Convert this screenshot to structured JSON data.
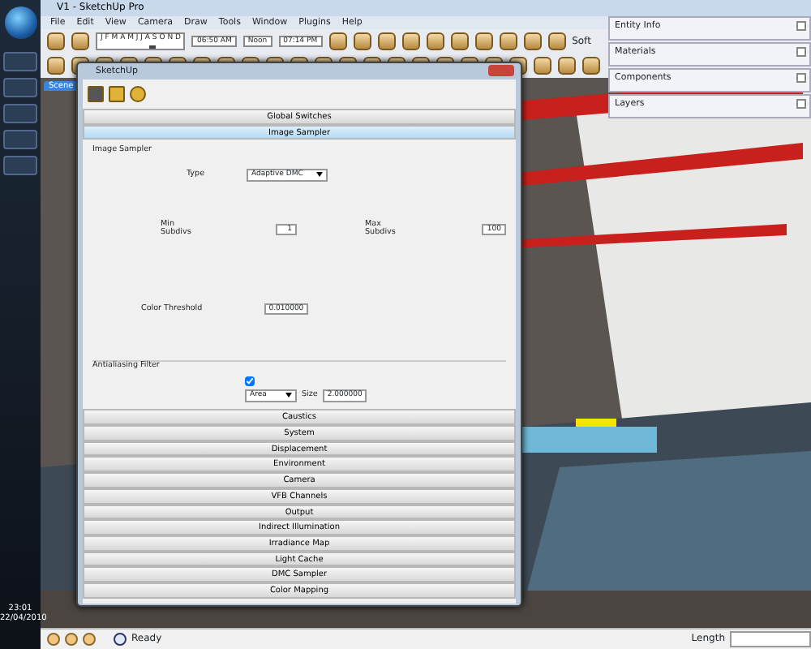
{
  "taskbar": {
    "clock_time": "23:01",
    "clock_date": "22/04/2010"
  },
  "window": {
    "title": "V1 - SketchUp Pro"
  },
  "menu": [
    "File",
    "Edit",
    "View",
    "Camera",
    "Draw",
    "Tools",
    "Window",
    "Plugins",
    "Help"
  ],
  "shadow_toolbar": {
    "month_slider": {
      "scale": "J F M A M J J A S O N D",
      "level": 0.6
    },
    "time_start": "06:50 AM",
    "time_noon": "Noon",
    "time_end": "07:14 PM"
  },
  "style_label": "Soft",
  "scene_tabs": [
    {
      "label": "Scene",
      "selected": true
    }
  ],
  "trays": [
    {
      "title": "Entity Info"
    },
    {
      "title": "Materials"
    },
    {
      "title": "Components"
    },
    {
      "title": "Layers"
    }
  ],
  "dialog": {
    "title": "SketchUp",
    "sections_above": [
      {
        "label": "Global Switches",
        "selected": false
      },
      {
        "label": "Image Sampler",
        "selected": true
      }
    ],
    "image_sampler": {
      "group_title": "Image Sampler",
      "type_label": "Type",
      "type_value": "Adaptive DMC",
      "min_label": "Min Subdivs",
      "min_value": "1",
      "max_label": "Max Subdivs",
      "max_value": "100",
      "threshold_label": "Color Threshold",
      "threshold_value": "0.010000",
      "filter_title": "Antialiasing Filter",
      "filter_on": true,
      "filter_value": "Area",
      "size_label": "Size",
      "size_value": "2.000000"
    },
    "sections_below": [
      {
        "label": "Caustics",
        "selected": false
      },
      {
        "label": "System",
        "selected": false
      },
      {
        "label": "Displacement",
        "selected": false
      },
      {
        "label": "Environment",
        "selected": false
      },
      {
        "label": "Camera",
        "selected": false
      },
      {
        "label": "VFB Channels",
        "selected": false
      },
      {
        "label": "Output",
        "selected": false
      },
      {
        "label": "Indirect Illumination",
        "selected": false
      },
      {
        "label": "Irradiance Map",
        "selected": false
      },
      {
        "label": "Light Cache",
        "selected": false
      },
      {
        "label": "DMC Sampler",
        "selected": false
      },
      {
        "label": "Color Mapping",
        "selected": false
      }
    ]
  },
  "status_bar": {
    "text": "Ready",
    "measure_label": "Length"
  }
}
